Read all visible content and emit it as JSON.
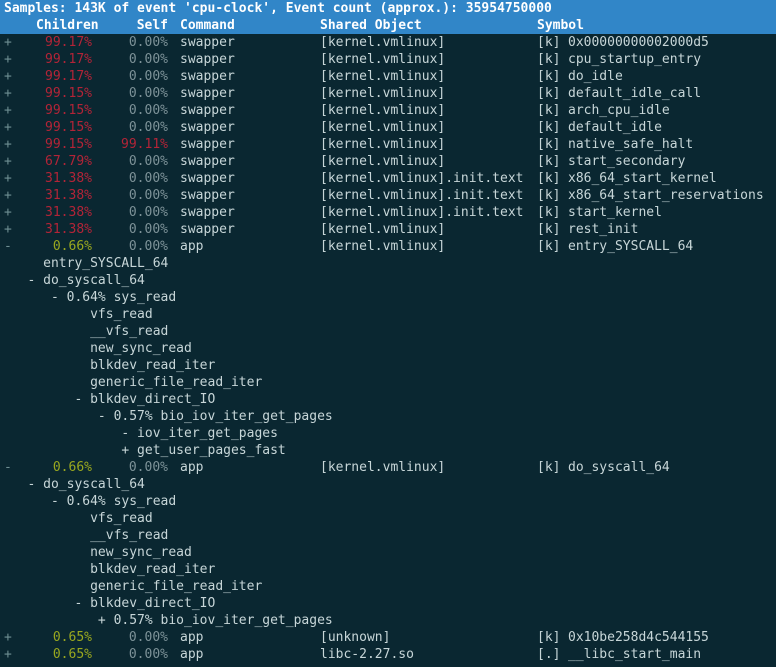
{
  "titlebar": {
    "text": "Samples: 143K of event 'cpu-clock', Event count (approx.): 35954750000"
  },
  "columns": {
    "children": "Children",
    "self": "Self",
    "command": "Command",
    "shared_object": "Shared Object",
    "symbol": "Symbol"
  },
  "colors": {
    "header_bg": "#3186c8",
    "header_fg": "#ffffff",
    "background": "#0a2731",
    "percent_hot": "#b32437",
    "percent_warm": "#9aa81f",
    "percent_zero": "#7d9298",
    "text": "#c7d6d8",
    "tree": "#8ea3a7"
  },
  "entries": [
    {
      "kind": "row",
      "sign": "+",
      "children": "99.17%",
      "children_class": "pct-hot",
      "self": "0.00%",
      "self_class": "pct-zero",
      "command": "swapper",
      "dso": "[kernel.vmlinux]",
      "symprefix": "[k]",
      "symbol": "0x00000000002000d5"
    },
    {
      "kind": "row",
      "sign": "+",
      "children": "99.17%",
      "children_class": "pct-hot",
      "self": "0.00%",
      "self_class": "pct-zero",
      "command": "swapper",
      "dso": "[kernel.vmlinux]",
      "symprefix": "[k]",
      "symbol": "cpu_startup_entry"
    },
    {
      "kind": "row",
      "sign": "+",
      "children": "99.17%",
      "children_class": "pct-hot",
      "self": "0.00%",
      "self_class": "pct-zero",
      "command": "swapper",
      "dso": "[kernel.vmlinux]",
      "symprefix": "[k]",
      "symbol": "do_idle"
    },
    {
      "kind": "row",
      "sign": "+",
      "children": "99.15%",
      "children_class": "pct-hot",
      "self": "0.00%",
      "self_class": "pct-zero",
      "command": "swapper",
      "dso": "[kernel.vmlinux]",
      "symprefix": "[k]",
      "symbol": "default_idle_call"
    },
    {
      "kind": "row",
      "sign": "+",
      "children": "99.15%",
      "children_class": "pct-hot",
      "self": "0.00%",
      "self_class": "pct-zero",
      "command": "swapper",
      "dso": "[kernel.vmlinux]",
      "symprefix": "[k]",
      "symbol": "arch_cpu_idle"
    },
    {
      "kind": "row",
      "sign": "+",
      "children": "99.15%",
      "children_class": "pct-hot",
      "self": "0.00%",
      "self_class": "pct-zero",
      "command": "swapper",
      "dso": "[kernel.vmlinux]",
      "symprefix": "[k]",
      "symbol": "default_idle"
    },
    {
      "kind": "row",
      "sign": "+",
      "children": "99.15%",
      "children_class": "pct-hot",
      "self": "99.11%",
      "self_class": "pct-hot",
      "command": "swapper",
      "dso": "[kernel.vmlinux]",
      "symprefix": "[k]",
      "symbol": "native_safe_halt"
    },
    {
      "kind": "row",
      "sign": "+",
      "children": "67.79%",
      "children_class": "pct-hot",
      "self": "0.00%",
      "self_class": "pct-zero",
      "command": "swapper",
      "dso": "[kernel.vmlinux]",
      "symprefix": "[k]",
      "symbol": "start_secondary"
    },
    {
      "kind": "row",
      "sign": "+",
      "children": "31.38%",
      "children_class": "pct-hot",
      "self": "0.00%",
      "self_class": "pct-zero",
      "command": "swapper",
      "dso": "[kernel.vmlinux].init.text",
      "symprefix": "[k]",
      "symbol": "x86_64_start_kernel"
    },
    {
      "kind": "row",
      "sign": "+",
      "children": "31.38%",
      "children_class": "pct-hot",
      "self": "0.00%",
      "self_class": "pct-zero",
      "command": "swapper",
      "dso": "[kernel.vmlinux].init.text",
      "symprefix": "[k]",
      "symbol": "x86_64_start_reservations"
    },
    {
      "kind": "row",
      "sign": "+",
      "children": "31.38%",
      "children_class": "pct-hot",
      "self": "0.00%",
      "self_class": "pct-zero",
      "command": "swapper",
      "dso": "[kernel.vmlinux].init.text",
      "symprefix": "[k]",
      "symbol": "start_kernel"
    },
    {
      "kind": "row",
      "sign": "+",
      "children": "31.38%",
      "children_class": "pct-hot",
      "self": "0.00%",
      "self_class": "pct-zero",
      "command": "swapper",
      "dso": "[kernel.vmlinux]",
      "symprefix": "[k]",
      "symbol": "rest_init"
    },
    {
      "kind": "row",
      "sign": "-",
      "children": "0.66%",
      "children_class": "pct-warm",
      "self": "0.00%",
      "self_class": "pct-zero",
      "command": "app",
      "dso": "[kernel.vmlinux]",
      "symprefix": "[k]",
      "symbol": "entry_SYSCALL_64"
    },
    {
      "kind": "cc",
      "text": "     entry_SYSCALL_64"
    },
    {
      "kind": "cc",
      "text": "   - do_syscall_64"
    },
    {
      "kind": "cc",
      "text": "      - 0.64% sys_read"
    },
    {
      "kind": "cc",
      "text": "           vfs_read"
    },
    {
      "kind": "cc",
      "text": "           __vfs_read"
    },
    {
      "kind": "cc",
      "text": "           new_sync_read"
    },
    {
      "kind": "cc",
      "text": "           blkdev_read_iter"
    },
    {
      "kind": "cc",
      "text": "           generic_file_read_iter"
    },
    {
      "kind": "cc",
      "text": "         - blkdev_direct_IO"
    },
    {
      "kind": "cc",
      "text": "            - 0.57% bio_iov_iter_get_pages"
    },
    {
      "kind": "cc",
      "text": "               - iov_iter_get_pages"
    },
    {
      "kind": "cc",
      "text": "               + get_user_pages_fast"
    },
    {
      "kind": "row",
      "sign": "-",
      "children": "0.66%",
      "children_class": "pct-warm",
      "self": "0.00%",
      "self_class": "pct-zero",
      "command": "app",
      "dso": "[kernel.vmlinux]",
      "symprefix": "[k]",
      "symbol": "do_syscall_64"
    },
    {
      "kind": "cc",
      "text": "   - do_syscall_64"
    },
    {
      "kind": "cc",
      "text": "      - 0.64% sys_read"
    },
    {
      "kind": "cc",
      "text": "           vfs_read"
    },
    {
      "kind": "cc",
      "text": "           __vfs_read"
    },
    {
      "kind": "cc",
      "text": "           new_sync_read"
    },
    {
      "kind": "cc",
      "text": "           blkdev_read_iter"
    },
    {
      "kind": "cc",
      "text": "           generic_file_read_iter"
    },
    {
      "kind": "cc",
      "text": "         - blkdev_direct_IO"
    },
    {
      "kind": "cc",
      "text": "            + 0.57% bio_iov_iter_get_pages"
    },
    {
      "kind": "row",
      "sign": "+",
      "children": "0.65%",
      "children_class": "pct-warm",
      "self": "0.00%",
      "self_class": "pct-zero",
      "command": "app",
      "dso": "[unknown]",
      "symprefix": "[k]",
      "symbol": "0x10be258d4c544155"
    },
    {
      "kind": "row",
      "sign": "+",
      "children": "0.65%",
      "children_class": "pct-warm",
      "self": "0.00%",
      "self_class": "pct-zero",
      "command": "app",
      "dso": "libc-2.27.so",
      "symprefix": "[.]",
      "symbol": "__libc_start_main"
    }
  ]
}
